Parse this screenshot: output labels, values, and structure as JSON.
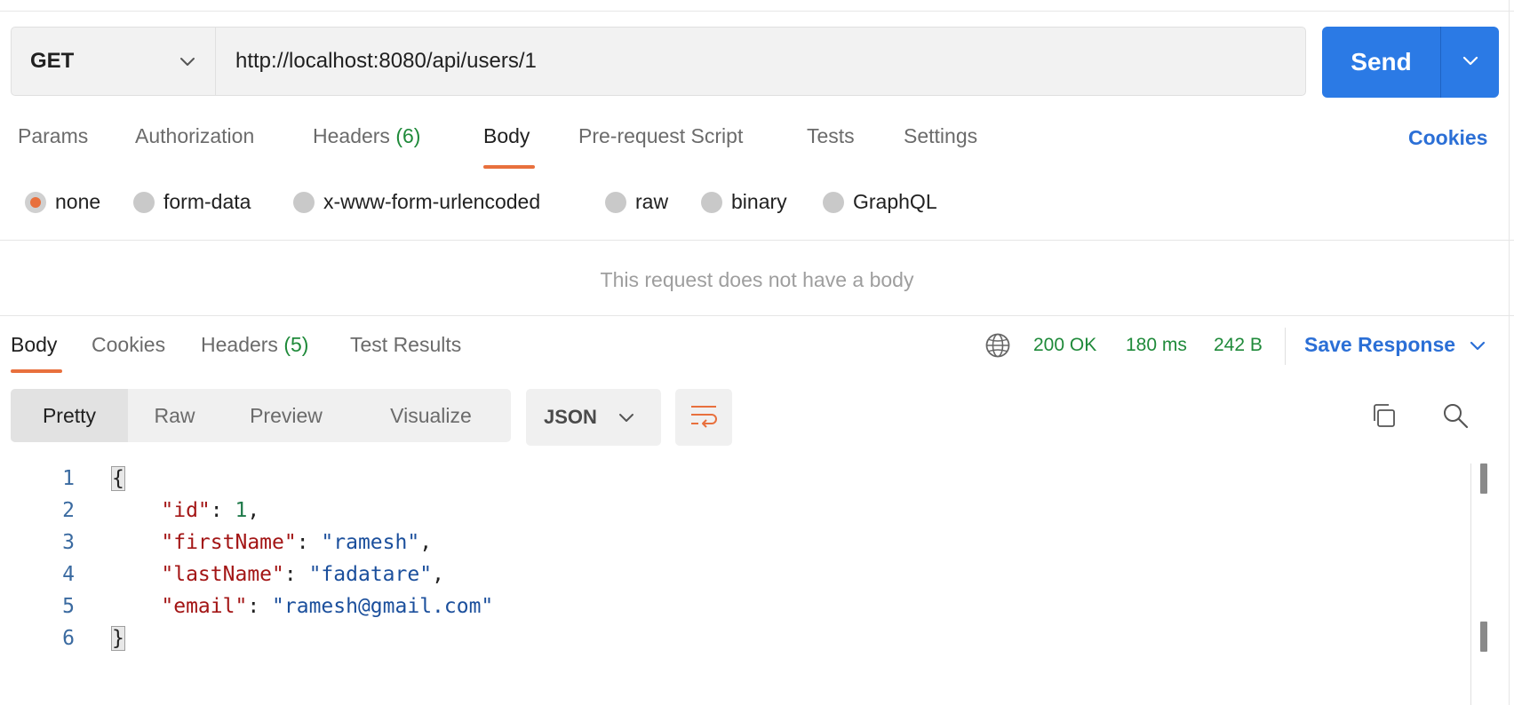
{
  "request": {
    "method": "GET",
    "url": "http://localhost:8080/api/users/1",
    "send_label": "Send"
  },
  "request_tabs": [
    {
      "label": "Params"
    },
    {
      "label": "Authorization"
    },
    {
      "label": "Headers",
      "count": "(6)"
    },
    {
      "label": "Body",
      "active": true
    },
    {
      "label": "Pre-request Script"
    },
    {
      "label": "Tests"
    },
    {
      "label": "Settings"
    }
  ],
  "cookies_label": "Cookies",
  "body_types": [
    {
      "label": "none",
      "selected": true
    },
    {
      "label": "form-data"
    },
    {
      "label": "x-www-form-urlencoded"
    },
    {
      "label": "raw"
    },
    {
      "label": "binary"
    },
    {
      "label": "GraphQL"
    }
  ],
  "no_body_message": "This request does not have a body",
  "response_tabs": [
    {
      "label": "Body",
      "active": true
    },
    {
      "label": "Cookies"
    },
    {
      "label": "Headers",
      "count": "(5)"
    },
    {
      "label": "Test Results"
    }
  ],
  "response_status": {
    "status": "200 OK",
    "time": "180 ms",
    "size": "242 B"
  },
  "save_response_label": "Save Response",
  "view_modes": [
    {
      "label": "Pretty",
      "active": true
    },
    {
      "label": "Raw"
    },
    {
      "label": "Preview"
    },
    {
      "label": "Visualize"
    }
  ],
  "format": "JSON",
  "code": {
    "line_numbers": [
      "1",
      "2",
      "3",
      "4",
      "5",
      "6"
    ],
    "open_brace": "{",
    "close_brace": "}",
    "fields": [
      {
        "key": "\"id\"",
        "value": "1",
        "type": "number",
        "comma": ","
      },
      {
        "key": "\"firstName\"",
        "value": "\"ramesh\"",
        "type": "string",
        "comma": ","
      },
      {
        "key": "\"lastName\"",
        "value": "\"fadatare\"",
        "type": "string",
        "comma": ","
      },
      {
        "key": "\"email\"",
        "value": "\"ramesh@gmail.com\"",
        "type": "string",
        "comma": ""
      }
    ]
  },
  "colors": {
    "accent_orange": "#e8703d",
    "send_blue": "#2b7ae5",
    "link_blue": "#2b6fd6",
    "status_green": "#1f8a3a"
  },
  "icons": [
    "chevron-down-icon",
    "globe-icon",
    "wrap-lines-icon",
    "copy-icon",
    "search-icon"
  ]
}
